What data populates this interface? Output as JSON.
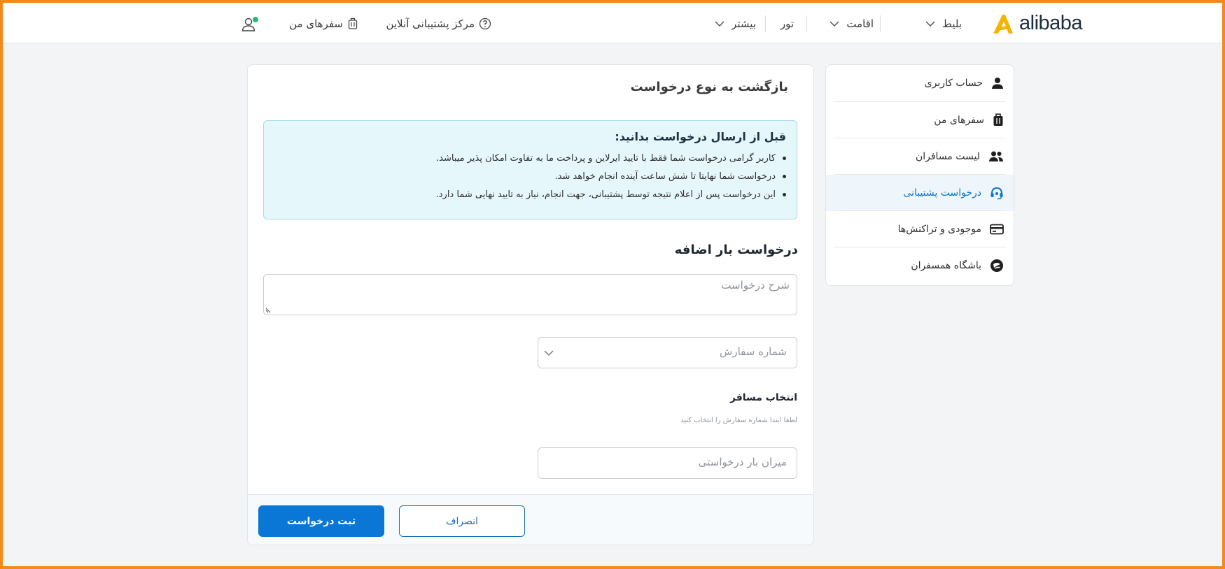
{
  "header": {
    "logo_text": "alibaba",
    "nav": {
      "ticket": "بلیط",
      "stay": "اقامت",
      "tour": "تور",
      "more": "بیشتر"
    },
    "support_center": "مرکز پشتیبانی آنلاین",
    "my_trips": "سفرهای من"
  },
  "sidebar": {
    "items": [
      {
        "label": "حساب کاربری",
        "icon": "user-icon"
      },
      {
        "label": "سفرهای من",
        "icon": "suitcase-icon"
      },
      {
        "label": "لیست مسافران",
        "icon": "users-icon"
      },
      {
        "label": "درخواست پشتیبانی",
        "icon": "headset-icon",
        "active": true
      },
      {
        "label": "موجودی و تراکنش‌ها",
        "icon": "card-icon"
      },
      {
        "label": "باشگاه همسفران",
        "icon": "club-icon"
      }
    ]
  },
  "main": {
    "back_title": "بازگشت به نوع درخواست",
    "info": {
      "title": "قبل از ارسال درخواست بدانید:",
      "bullets": [
        "کاربر گرامی درخواست شما فقط با تایید ایرلاین و پرداخت ما به تفاوت امکان پذیر میباشد.",
        "درخواست شما نهایتا تا شش ساعت آینده انجام خواهد شد.",
        "این درخواست پس از اعلام نتیجه توسط پشتیبانی، جهت انجام، نیاز به تایید نهایی شما دارد."
      ]
    },
    "section_title": "درخواست بار اضافه",
    "description_placeholder": "شرح درخواست",
    "order_placeholder": "شماره سفارش",
    "passenger_label": "انتخاب مسافر",
    "passenger_hint": "لطفا ابتدا شماره سفارش را انتخاب کنید",
    "amount_placeholder": "میزان بار درخواستی",
    "cancel_label": "انصراف",
    "submit_label": "ثبت درخواست"
  },
  "colors": {
    "brand_orange": "#f5b400",
    "primary_blue": "#0a77d6",
    "info_bg": "#e6f7fb",
    "frame_border": "#f28a1e"
  }
}
